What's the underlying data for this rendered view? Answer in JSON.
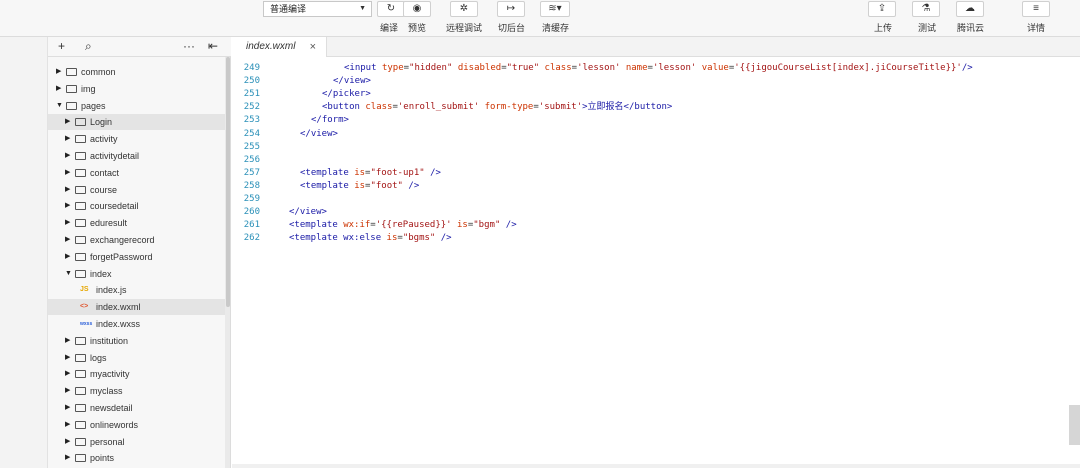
{
  "toolbar": {
    "compile_mode": "普通编译",
    "buttons": [
      {
        "label": "编译",
        "icon": "refresh-icon"
      },
      {
        "label": "预览",
        "icon": "eye-icon"
      },
      {
        "label": "远程调试",
        "icon": "bug-icon"
      },
      {
        "label": "切后台",
        "icon": "switch-background-icon"
      },
      {
        "label": "清缓存",
        "icon": "layers-icon"
      },
      {
        "label": "上传",
        "icon": "upload-icon"
      },
      {
        "label": "测试",
        "icon": "flask-icon"
      },
      {
        "label": "腾讯云",
        "icon": "cloud-icon"
      },
      {
        "label": "详情",
        "icon": "menu-icon"
      }
    ]
  },
  "tree_header": {
    "add": "+",
    "search": "⌕",
    "more": "···",
    "collapse": "⇤"
  },
  "tree": [
    {
      "label": "common",
      "type": "folder",
      "depth": 0,
      "expanded": false
    },
    {
      "label": "img",
      "type": "folder",
      "depth": 0,
      "expanded": false
    },
    {
      "label": "pages",
      "type": "folder",
      "depth": 0,
      "expanded": true
    },
    {
      "label": "Login",
      "type": "folder",
      "depth": 1,
      "expanded": false
    },
    {
      "label": "activity",
      "type": "folder",
      "depth": 1,
      "expanded": false
    },
    {
      "label": "activitydetail",
      "type": "folder",
      "depth": 1,
      "expanded": false
    },
    {
      "label": "contact",
      "type": "folder",
      "depth": 1,
      "expanded": false
    },
    {
      "label": "course",
      "type": "folder",
      "depth": 1,
      "expanded": false
    },
    {
      "label": "coursedetail",
      "type": "folder",
      "depth": 1,
      "expanded": false
    },
    {
      "label": "eduresult",
      "type": "folder",
      "depth": 1,
      "expanded": false
    },
    {
      "label": "exchangerecord",
      "type": "folder",
      "depth": 1,
      "expanded": false
    },
    {
      "label": "forgetPassword",
      "type": "folder",
      "depth": 1,
      "expanded": false
    },
    {
      "label": "index",
      "type": "folder",
      "depth": 1,
      "expanded": true
    },
    {
      "label": "index.js",
      "type": "js",
      "depth": 2
    },
    {
      "label": "index.wxml",
      "type": "wxml",
      "depth": 2,
      "selected": true
    },
    {
      "label": "index.wxss",
      "type": "wxss",
      "depth": 2
    },
    {
      "label": "institution",
      "type": "folder",
      "depth": 1,
      "expanded": false
    },
    {
      "label": "logs",
      "type": "folder",
      "depth": 1,
      "expanded": false
    },
    {
      "label": "myactivity",
      "type": "folder",
      "depth": 1,
      "expanded": false
    },
    {
      "label": "myclass",
      "type": "folder",
      "depth": 1,
      "expanded": false
    },
    {
      "label": "newsdetail",
      "type": "folder",
      "depth": 1,
      "expanded": false
    },
    {
      "label": "onlinewords",
      "type": "folder",
      "depth": 1,
      "expanded": false
    },
    {
      "label": "personal",
      "type": "folder",
      "depth": 1,
      "expanded": false
    },
    {
      "label": "points",
      "type": "folder",
      "depth": 1,
      "expanded": false
    }
  ],
  "file_icons": {
    "js": "JS",
    "wxml": "<>",
    "wxss": "wxss"
  },
  "editor": {
    "tab_label": "index.wxml",
    "tab_close": "×",
    "lines": [
      {
        "n": "249",
        "indent": 6,
        "code": "<input type=\"hidden\" disabled=\"true\" class='lesson' name='lesson' value='{{jigouCourseList[index].jiCourseTitle}}'/>"
      },
      {
        "n": "250",
        "indent": 5,
        "code": "</view>"
      },
      {
        "n": "251",
        "indent": 4,
        "code": "</picker>"
      },
      {
        "n": "252",
        "indent": 4,
        "code": "<button class='enroll_submit' form-type='submit'>立即报名</button>"
      },
      {
        "n": "253",
        "indent": 3,
        "code": "</form>"
      },
      {
        "n": "254",
        "indent": 2,
        "code": "</view>"
      },
      {
        "n": "255",
        "indent": 0,
        "code": ""
      },
      {
        "n": "256",
        "indent": 0,
        "code": ""
      },
      {
        "n": "257",
        "indent": 2,
        "code": "<template is=\"foot-up1\" />"
      },
      {
        "n": "258",
        "indent": 2,
        "code": "<template is=\"foot\" />"
      },
      {
        "n": "259",
        "indent": 0,
        "code": ""
      },
      {
        "n": "260",
        "indent": 1,
        "code": "</view>"
      },
      {
        "n": "261",
        "indent": 1,
        "code": "<template wx:if='{{rePaused}}' is=\"bgm\" />"
      },
      {
        "n": "262",
        "indent": 1,
        "code": "<template wx:else is=\"bgms\" />"
      }
    ]
  },
  "colors": {
    "tag": "#1a1aa6",
    "attr": "#cc3300",
    "string": "#a31515",
    "line_number": "#2a90b8",
    "selected_row": "#e4e4e4"
  }
}
